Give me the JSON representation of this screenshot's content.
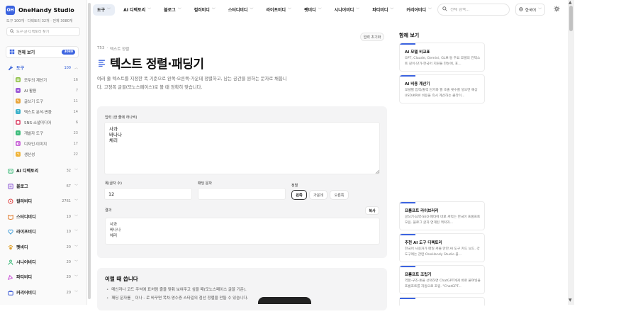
{
  "brand": {
    "name": "OneHandy Studio",
    "logo_text": "OH"
  },
  "sidebar": {
    "stats": "도구 100개 · 디렉토리 32개 · 전체 3080개",
    "search_placeholder": "도구·글·디렉토리 찾기",
    "all_view": {
      "label": "전체 보기",
      "count": "3080"
    },
    "active_category": {
      "label": "도구",
      "count": "100",
      "icon": "wrench-icon",
      "color": "#2d5ad6"
    },
    "subcategories": [
      {
        "label": "모두의 계산기",
        "count": "16",
        "color": "#8bbf3f",
        "icon": "calculator-icon"
      },
      {
        "label": "AI 활용",
        "count": "7",
        "color": "#9b59d6",
        "icon": "sparkle-icon"
      },
      {
        "label": "글쓰기 도구",
        "count": "11",
        "color": "#e8a43a",
        "icon": "pencil-icon"
      },
      {
        "label": "텍스트 분석·변환",
        "count": "14",
        "color": "#3bb0c9",
        "icon": "text-icon"
      },
      {
        "label": "SNS·소셜미디어",
        "count": "6",
        "color": "#e05a7a",
        "icon": "share-icon"
      },
      {
        "label": "개발자 도구",
        "count": "23",
        "color": "#3dbb7a",
        "icon": "code-icon"
      },
      {
        "label": "디자인·이미지",
        "count": "17",
        "color": "#c865d8",
        "icon": "palette-icon"
      },
      {
        "label": "생산성",
        "count": "22",
        "color": "#f0b43a",
        "icon": "bolt-icon"
      }
    ],
    "categories": [
      {
        "label": "AI 디렉토리",
        "count": "32",
        "icon": "robot-icon",
        "color": "#3dbb7a"
      },
      {
        "label": "블로그",
        "count": "67",
        "icon": "blog-icon",
        "color": "#8e5ad6"
      },
      {
        "label": "컬러비디",
        "count": "2761",
        "icon": "color-icon",
        "color": "#e04a4a"
      },
      {
        "label": "스터디비디",
        "count": "10",
        "icon": "study-icon",
        "color": "#e07a2a"
      },
      {
        "label": "라이프비디",
        "count": "10",
        "icon": "life-icon",
        "color": "#3a9ad6"
      },
      {
        "label": "펫비디",
        "count": "20",
        "icon": "pet-icon",
        "color": "#e0a02a"
      },
      {
        "label": "시니어비디",
        "count": "20",
        "icon": "senior-icon",
        "color": "#3dbb7a"
      },
      {
        "label": "파티비디",
        "count": "20",
        "icon": "party-icon",
        "color": "#c84ad6"
      },
      {
        "label": "커리어비디",
        "count": "20",
        "icon": "career-icon",
        "color": "#3a5ad6"
      }
    ]
  },
  "topnav": {
    "items": [
      "도구",
      "AI 디렉토리",
      "블로그",
      "컬러비디",
      "스터디비디",
      "라이프비디",
      "펫비디",
      "시니어비디",
      "파티비디",
      "커리어비디"
    ],
    "search_placeholder": "전체 검색...",
    "language": "한국어"
  },
  "main": {
    "reset_label": "입력 초기화",
    "breadcrumb": [
      "T53",
      "텍스트 정렬"
    ],
    "title": "텍스트 정렬·패딩기",
    "description": "여러 줄 텍스트를 지정한 폭 기준으로 왼쪽·오른쪽·가운데 정렬하고, 남는 공간을 원하는 문자로 채웁니다. 고정폭 글꼴(모노스페이스)로 볼 때 정확히 맞습니다.",
    "input_label": "입력 (한 줄에 하나씩)",
    "input_value": "사과\n바나나\n체리",
    "width_label": "폭(글자 수)",
    "width_value": "12",
    "pad_label": "패딩 문자",
    "pad_value": "",
    "align_label": "정렬",
    "align_options": [
      "왼쪽",
      "가운데",
      "오른쪽"
    ],
    "align_selected": "왼쪽",
    "result_label": "결과",
    "copy_label": "복사",
    "result_lines": [
      "사과",
      "바나나",
      "체리"
    ],
    "uses_title": "이럴 때 씁니다",
    "uses": [
      "메신저나 코드 주석에 표처럼 줄을 맞춰 보여주고 싶을 때(모노스페이스 글꼴 기준).",
      "패딩 문자를 _ 이나 - 로 바꾸면 목차·영수증 스타일의 점선 정렬을 만들 수 있습니다."
    ]
  },
  "right_panel": {
    "title": "함께 보기",
    "cards_top": [
      {
        "title": "AI 모델 비교표",
        "desc": "GPT, Claude, Gemini, GLM 등 주요 모델의 컨텍스트 길이·단가·한국어 지원을 한눈에, 표..."
      },
      {
        "title": "AI 비용 계산기",
        "desc": "모델별 입력/출력 단가와 월 호출 횟수를 넣으면 예상 USD/KRW 비용을 즉시 계산하는 클라이..."
      }
    ],
    "cards_bottom": [
      {
        "title": "프롬프트 라이브러리",
        "desc": "글쓰기·요약·SEO·메타에 바로 써먹는 한국어 프롬프트 모음. 블로그 글과 연계된 맥락과..."
      },
      {
        "title": "추천 AI 도구 디렉토리",
        "desc": "한국어 사용자가 매일 써볼 만한 AI 도구 카드 보드. 각 도구에는 관련 OneHandy Studio 블..."
      },
      {
        "title": "프롬프트 조립기",
        "desc": "역할·구조·톤을 선택하면 ChatGPT에게 바로 붙여넣을 프롬프트를 자동으로 조립. \"ChatGPT..."
      }
    ]
  }
}
